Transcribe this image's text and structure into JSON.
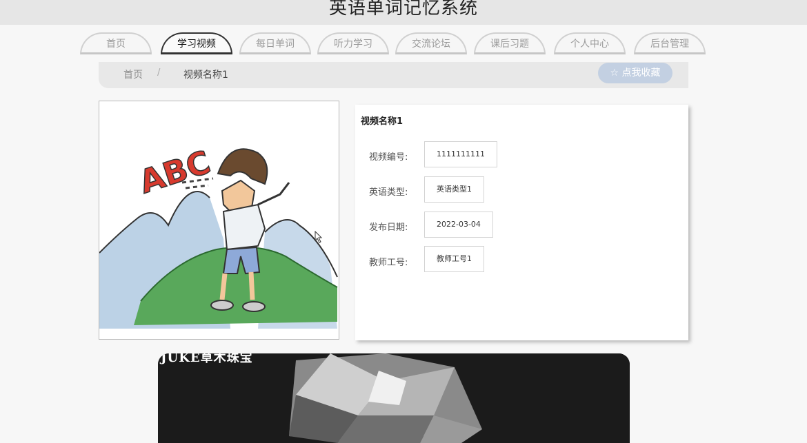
{
  "header": {
    "site_title": "英语单词记忆系统"
  },
  "nav": {
    "tabs": [
      {
        "label": "首页"
      },
      {
        "label": "学习视频"
      },
      {
        "label": "每日单词"
      },
      {
        "label": "听力学习"
      },
      {
        "label": "交流论坛"
      },
      {
        "label": "课后习题"
      },
      {
        "label": "个人中心"
      },
      {
        "label": "后台管理"
      }
    ],
    "active_index": 1
  },
  "breadcrumb": {
    "home": "首页",
    "separator": "/",
    "current": "视频名称1"
  },
  "favorite_button": {
    "icon": "star-outline-icon",
    "label": "☆ 点我收藏"
  },
  "thumbnail": {
    "caption_letters": "ABC"
  },
  "detail": {
    "title": "视频名称1",
    "fields": [
      {
        "label": "视频编号:",
        "value": "1111111111"
      },
      {
        "label": "英语类型:",
        "value": "英语类型1"
      },
      {
        "label": "发布日期:",
        "value": "2022-03-04"
      },
      {
        "label": "教师工号:",
        "value": "教师工号1"
      }
    ]
  },
  "video": {
    "overlay_text": "JUKE草木珠宝"
  },
  "colors": {
    "accent": "#c3d0e2",
    "active_tab_border": "#333333"
  }
}
